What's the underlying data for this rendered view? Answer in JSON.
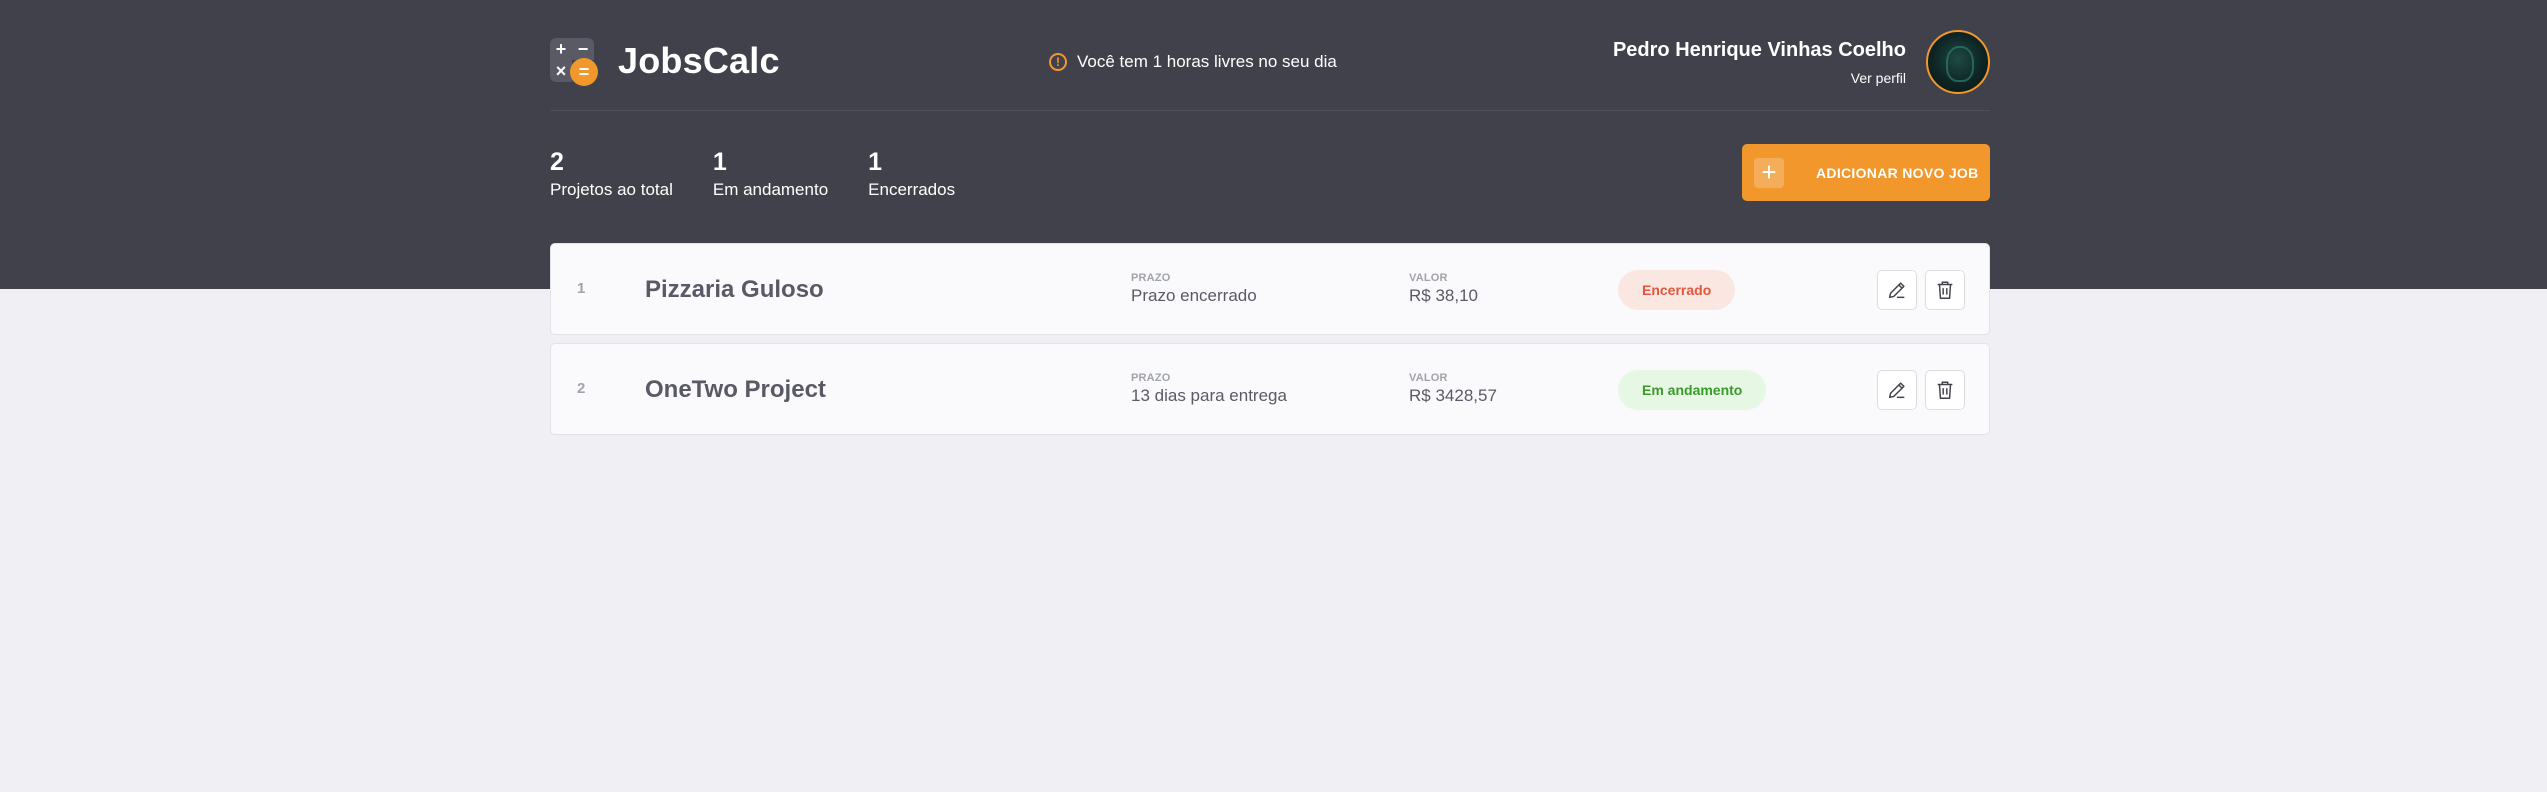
{
  "app": {
    "name": "JobsCalc",
    "logo_symbols": {
      "plus": "+",
      "minus": "−",
      "times": "×",
      "equals": "="
    }
  },
  "header": {
    "free_hours_text": "Você tem 1 horas livres no seu dia",
    "profile": {
      "name": "Pedro Henrique Vinhas Coelho",
      "link_label": "Ver perfil"
    }
  },
  "summary": [
    {
      "count": "2",
      "label": "Projetos ao total"
    },
    {
      "count": "1",
      "label": "Em andamento"
    },
    {
      "count": "1",
      "label": "Encerrados"
    }
  ],
  "add_job": {
    "icon": "+",
    "label": "ADICIONAR NOVO JOB"
  },
  "jobs": [
    {
      "id": "1",
      "name": "Pizzaria Guloso",
      "deadline_label": "PRAZO",
      "deadline_value": "Prazo encerrado",
      "value_label": "VALOR",
      "value": "R$ 38,10",
      "status": "Encerrado"
    },
    {
      "id": "2",
      "name": "OneTwo Project",
      "deadline_label": "PRAZO",
      "deadline_value": "13 dias para entrega",
      "value_label": "VALOR",
      "value": "R$ 3428,57",
      "status": "Em andamento"
    }
  ],
  "colors": {
    "header_bg": "#41414c",
    "accent": "#f1972c",
    "page_bg": "#f0f0f4",
    "status_closed": "#e2573b",
    "status_progress": "#3b9a2b"
  },
  "icons": {
    "alert": "alert-circle-icon",
    "edit": "pencil-icon",
    "delete": "trash-icon",
    "add": "plus-icon"
  }
}
